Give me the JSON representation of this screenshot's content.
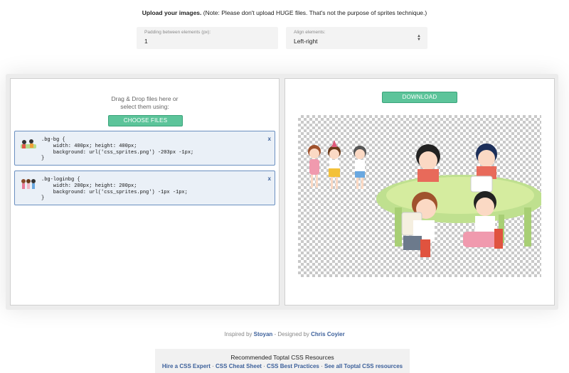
{
  "intro": {
    "bold": "Upload your images.",
    "note": " (Note: Please don't upload HUGE files. That's not the purpose of sprites technique.)"
  },
  "options": {
    "padding_label": "Padding between elements (px):",
    "padding_value": "1",
    "align_label": "Align elements:",
    "align_value": "Left-right"
  },
  "left": {
    "drop_line1": "Drag & Drop files here or",
    "drop_line2": "select them using:",
    "choose_label": "CHOOSE FILES",
    "items": [
      {
        "code": ".bg-bg {\n    width: 400px; height: 400px;\n    background: url('css_sprites.png') -203px -1px;\n}",
        "close": "x"
      },
      {
        "code": ".bg-loginbg {\n    width: 200px; height: 200px;\n    background: url('css_sprites.png') -1px -1px;\n}",
        "close": "x"
      }
    ]
  },
  "right": {
    "download_label": "DOWNLOAD"
  },
  "footer": {
    "inspired": "Inspired by",
    "stoyan": "Stoyan",
    "designed": "- Designed by",
    "chris": "Chris Coyier"
  },
  "resources": {
    "title": "Recommended Toptal CSS Resources",
    "links": [
      "Hire a CSS Expert",
      "CSS Cheat Sheet",
      "CSS Best Practices",
      "See all Toptal CSS resources"
    ],
    "separator": " · "
  }
}
